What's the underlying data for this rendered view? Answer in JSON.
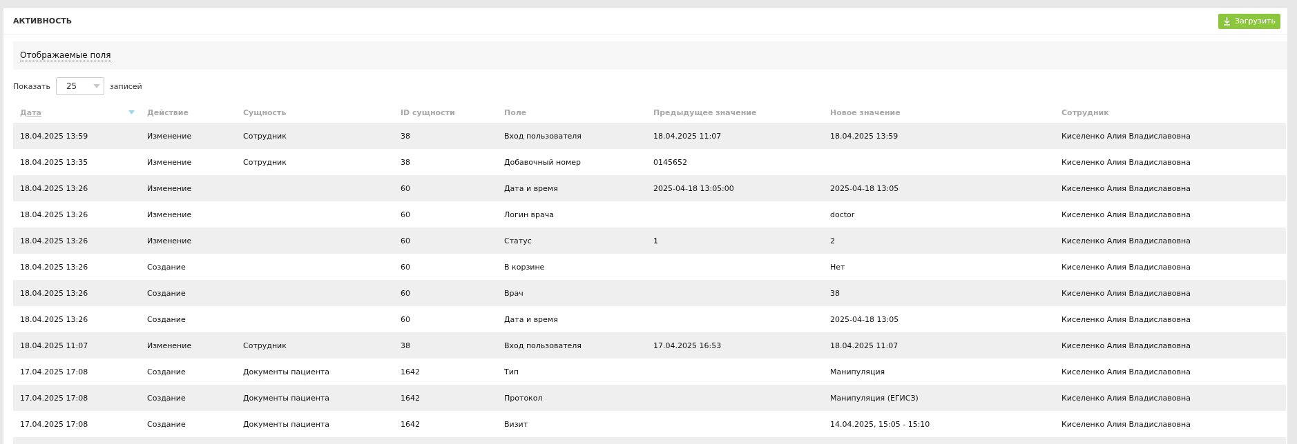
{
  "panel": {
    "title": "АКТИВНОСТЬ",
    "download_button": "Загрузить"
  },
  "fields_toggle": "Отображаемые поля",
  "page_size": {
    "prefix": "Показать",
    "value": "25",
    "suffix": "записей"
  },
  "table": {
    "columns": [
      {
        "label": "Дата",
        "sorted": true
      },
      {
        "label": "Действие",
        "sorted": false
      },
      {
        "label": "Сущность",
        "sorted": false
      },
      {
        "label": "ID сущности",
        "sorted": false
      },
      {
        "label": "Поле",
        "sorted": false
      },
      {
        "label": "Предыдущее значение",
        "sorted": false
      },
      {
        "label": "Новое значение",
        "sorted": false
      },
      {
        "label": "Сотрудник",
        "sorted": false
      }
    ],
    "rows": [
      [
        "18.04.2025 13:59",
        "Изменение",
        "Сотрудник",
        "38",
        "Вход пользователя",
        "18.04.2025 11:07",
        "18.04.2025 13:59",
        "Киселенко Алия Владиславовна"
      ],
      [
        "18.04.2025 13:35",
        "Изменение",
        "Сотрудник",
        "38",
        "Добавочный номер",
        "0145652",
        "",
        "Киселенко Алия Владиславовна"
      ],
      [
        "18.04.2025 13:26",
        "Изменение",
        "",
        "60",
        "Дата и время",
        "2025-04-18 13:05:00",
        "2025-04-18 13:05",
        "Киселенко Алия Владиславовна"
      ],
      [
        "18.04.2025 13:26",
        "Изменение",
        "",
        "60",
        "Логин врача",
        "",
        "doctor",
        "Киселенко Алия Владиславовна"
      ],
      [
        "18.04.2025 13:26",
        "Изменение",
        "",
        "60",
        "Статус",
        "1",
        "2",
        "Киселенко Алия Владиславовна"
      ],
      [
        "18.04.2025 13:26",
        "Создание",
        "",
        "60",
        "В корзине",
        "",
        "Нет",
        "Киселенко Алия Владиславовна"
      ],
      [
        "18.04.2025 13:26",
        "Создание",
        "",
        "60",
        "Врач",
        "",
        "38",
        "Киселенко Алия Владиславовна"
      ],
      [
        "18.04.2025 13:26",
        "Создание",
        "",
        "60",
        "Дата и время",
        "",
        "2025-04-18 13:05",
        "Киселенко Алия Владиславовна"
      ],
      [
        "18.04.2025 11:07",
        "Изменение",
        "Сотрудник",
        "38",
        "Вход пользователя",
        "17.04.2025 16:53",
        "18.04.2025 11:07",
        "Киселенко Алия Владиславовна"
      ],
      [
        "17.04.2025 17:08",
        "Создание",
        "Документы пациента",
        "1642",
        "Тип",
        "",
        "Манипуляция",
        "Киселенко Алия Владиславовна"
      ],
      [
        "17.04.2025 17:08",
        "Создание",
        "Документы пациента",
        "1642",
        "Протокол",
        "",
        "Манипуляция (ЕГИСЗ)",
        "Киселенко Алия Владиславовна"
      ],
      [
        "17.04.2025 17:08",
        "Создание",
        "Документы пациента",
        "1642",
        "Визит",
        "",
        "14.04.2025, 15:05 - 15:10",
        "Киселенко Алия Владиславовна"
      ]
    ]
  }
}
